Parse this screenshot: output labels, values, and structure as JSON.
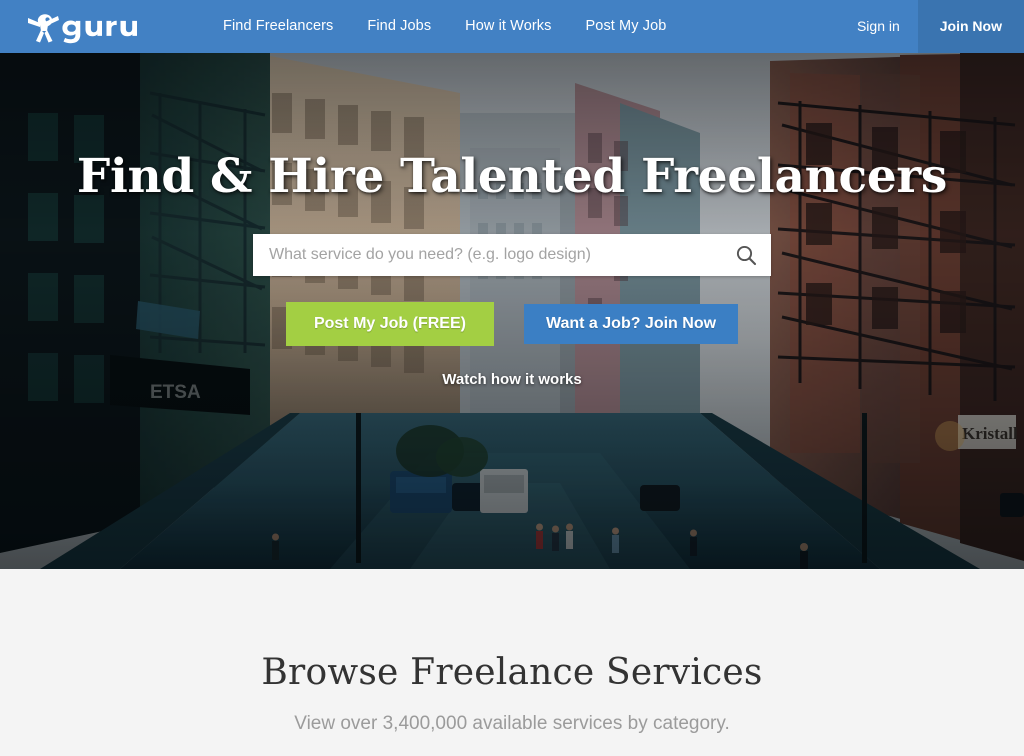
{
  "nav": {
    "logo_text": "guru",
    "logo_icon": "guru-mascot-icon",
    "links": [
      {
        "label": "Find Freelancers"
      },
      {
        "label": "Find Jobs"
      },
      {
        "label": "How it Works"
      },
      {
        "label": "Post My Job"
      }
    ],
    "signin_label": "Sign in",
    "joinnow_label": "Join Now"
  },
  "hero": {
    "title": "Find & Hire Talented Freelancers",
    "search": {
      "placeholder": "What service do you need? (e.g. logo design)",
      "value": "",
      "icon": "search-icon"
    },
    "cta_primary": "Post My Job (FREE)",
    "cta_secondary": "Want a Job? Join Now",
    "watch_link": "Watch how it works",
    "background_signs": [
      {
        "text": "ETSA"
      },
      {
        "text": "Kristall"
      }
    ]
  },
  "browse": {
    "title": "Browse Freelance Services",
    "subtitle": "View over 3,400,000 available services by category."
  },
  "colors": {
    "nav_blue": "#4281c4",
    "join_blue": "#3a74b0",
    "cta_green": "#a3cf43",
    "cta_blue": "#3b7fc4",
    "section_bg": "#f4f4f4",
    "heading_dark": "#333333",
    "muted_gray": "#9b9b9b"
  }
}
